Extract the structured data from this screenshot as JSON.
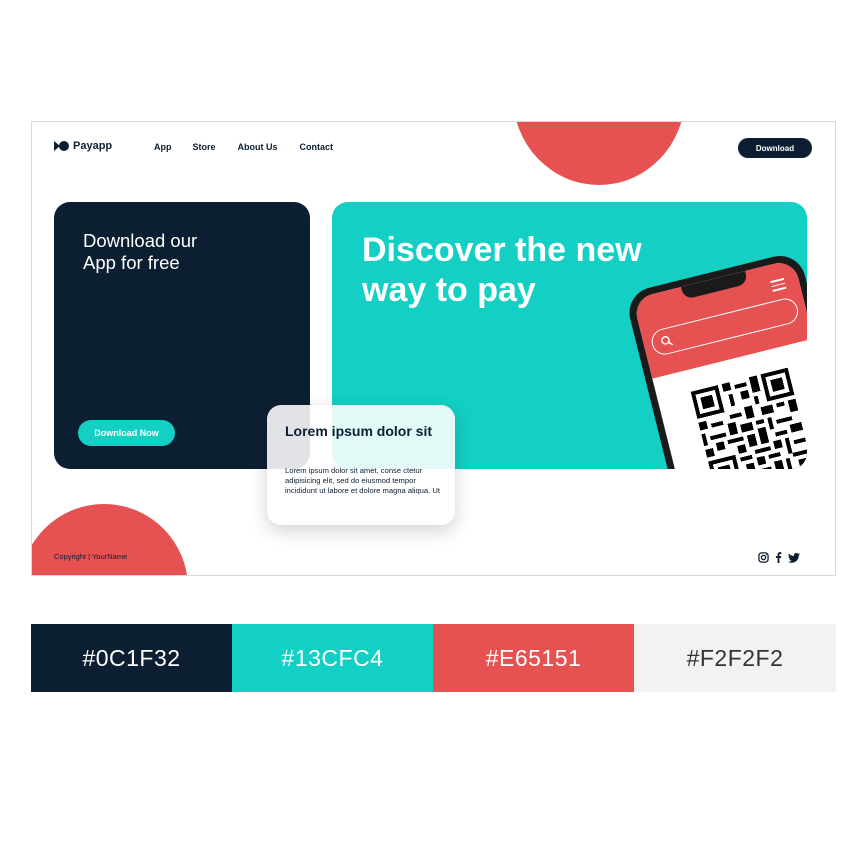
{
  "colors": {
    "navy": "#0C1F32",
    "teal": "#13CFC4",
    "coral": "#E65151",
    "light_gray": "#F2F2F2"
  },
  "header": {
    "logo_text": "Payapp",
    "logo_icon": "payapp-logo-icon",
    "nav": [
      "App",
      "Store",
      "About Us",
      "Contact"
    ],
    "download_button": "Download"
  },
  "hero": {
    "left_card": {
      "title": "Download our App for free",
      "button": "Download Now"
    },
    "right_card": {
      "title": "Discover the new way to pay",
      "phone_icons": [
        "menu-icon",
        "search-icon",
        "qr-code-icon"
      ]
    },
    "info_card": {
      "title": "Lorem ipsum dolor sit",
      "body": "Lorem ipsum dolor sit amet, conse ctetur adipisicing elit, sed do eiusmod tempor incididunt ut labore et dolore magna aliqua. Ut"
    }
  },
  "footer": {
    "copyright": "Copyright | YourName",
    "social_icons": [
      "instagram-icon",
      "facebook-icon",
      "twitter-icon"
    ]
  },
  "palette": [
    "#0C1F32",
    "#13CFC4",
    "#E65151",
    "#F2F2F2"
  ]
}
